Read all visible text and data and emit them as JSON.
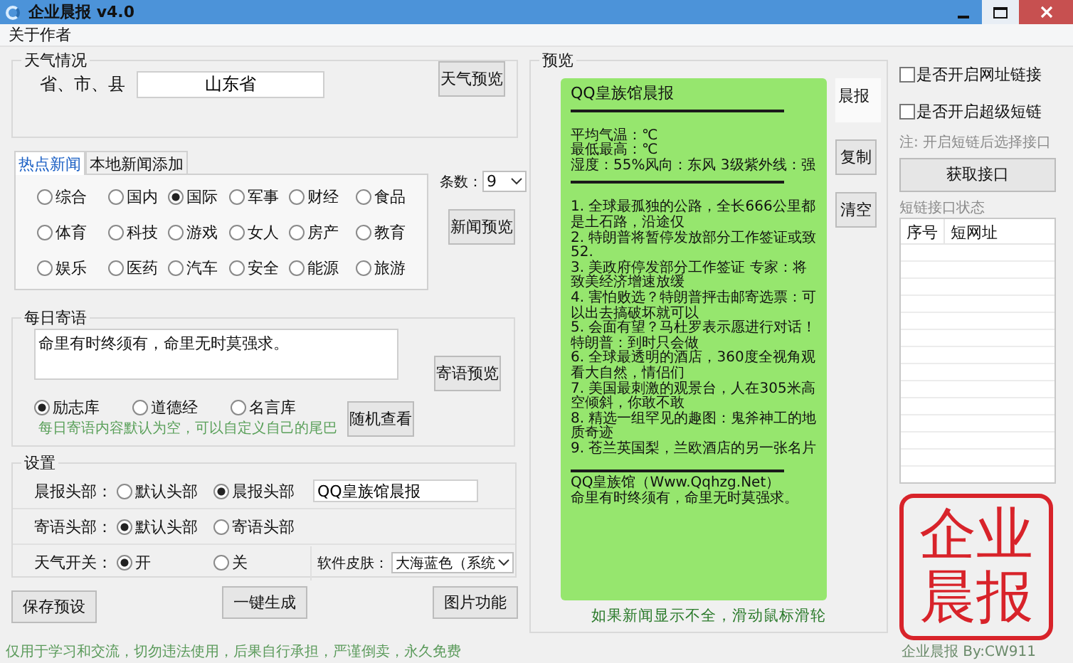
{
  "window": {
    "title": "企业晨报 v4.0"
  },
  "menu": [
    "关于作者"
  ],
  "weather": {
    "title": "天气情况",
    "label": "省、市、县",
    "value": "山东省",
    "button": "天气预览"
  },
  "news": {
    "tabs": [
      {
        "label": "热点新闻",
        "selected": true
      },
      {
        "label": "本地新闻添加",
        "selected": false
      }
    ],
    "categories": [
      {
        "label": "综合",
        "selected": false
      },
      {
        "label": "国内",
        "selected": false
      },
      {
        "label": "国际",
        "selected": true
      },
      {
        "label": "军事",
        "selected": false
      },
      {
        "label": "财经",
        "selected": false
      },
      {
        "label": "食品",
        "selected": false
      },
      {
        "label": "体育",
        "selected": false
      },
      {
        "label": "科技",
        "selected": false
      },
      {
        "label": "游戏",
        "selected": false
      },
      {
        "label": "女人",
        "selected": false
      },
      {
        "label": "房产",
        "selected": false
      },
      {
        "label": "教育",
        "selected": false
      },
      {
        "label": "娱乐",
        "selected": false
      },
      {
        "label": "医药",
        "selected": false
      },
      {
        "label": "汽车",
        "selected": false
      },
      {
        "label": "安全",
        "selected": false
      },
      {
        "label": "能源",
        "selected": false
      },
      {
        "label": "旅游",
        "selected": false
      }
    ],
    "count_label": "条数：",
    "count_value": "9",
    "button": "新闻预览"
  },
  "motto": {
    "title": "每日寄语",
    "text": "命里有时终须有，命里无时莫强求。",
    "preview_button": "寄语预览",
    "sources": [
      {
        "label": "励志库",
        "selected": true
      },
      {
        "label": "道德经",
        "selected": false
      },
      {
        "label": "名言库",
        "selected": false
      }
    ],
    "random_button": "随机查看",
    "hint": "每日寄语内容默认为空，可以自定义自己的尾巴"
  },
  "settings": {
    "title": "设置",
    "rows": [
      {
        "label": "晨报头部：",
        "options": [
          {
            "label": "默认头部",
            "selected": false
          },
          {
            "label": "晨报头部",
            "selected": true
          }
        ],
        "value": "QQ皇族馆晨报"
      },
      {
        "label": "寄语头部：",
        "options": [
          {
            "label": "默认头部",
            "selected": true
          },
          {
            "label": "寄语头部",
            "selected": false
          }
        ]
      },
      {
        "label": "天气开关：",
        "options": [
          {
            "label": "开",
            "selected": true
          },
          {
            "label": "关",
            "selected": false
          }
        ],
        "skin_label": "软件皮肤：",
        "skin_value": "大海蓝色（系统"
      }
    ]
  },
  "buttons": [
    "保存预设",
    "一键生成",
    "图片功能"
  ],
  "preview": {
    "title": "预览",
    "header": "QQ皇族馆晨报",
    "weather_lines": [
      "平均气温：℃",
      "最低最高：℃",
      "湿度：55%风向：东风 3级紫外线：强"
    ],
    "news": [
      "1. 全球最孤独的公路，全长666公里都是土石路，沿途仅",
      "2. 特朗普将暂停发放部分工作签证或致52.",
      "3. 美政府停发部分工作签证 专家：将致美经济增速放缓",
      "4. 害怕败选？特朗普抨击邮寄选票：可以出去搞破坏就可以",
      "5. 会面有望？马杜罗表示愿进行对话！特朗普：到时只会做",
      "6. 全球最透明的酒店，360度全视角观看大自然，情侣们",
      "7. 美国最刺激的观景台，人在305米高空倾斜，你敢不敢",
      "8. 精选一组罕见的趣图：鬼斧神工的地质奇迹",
      "9. 苍兰英国梨，兰欧酒店的另一张名片"
    ],
    "site": "QQ皇族馆（Www.Qqhzg.Net）",
    "motto": "命里有时终须有，命里无时莫强求。",
    "side_tab": "晨报",
    "buttons": [
      "复制",
      "清空"
    ],
    "hint": "如果新闻显示不全，滑动鼠标滑轮"
  },
  "links": {
    "options": [
      {
        "label": "是否开启网址链接",
        "checked": false
      },
      {
        "label": "是否开启超级短链",
        "checked": false
      }
    ],
    "note": "注: 开启短链后选择接口",
    "button": "获取接口",
    "status_title": "短链接口状态",
    "columns": [
      "序号",
      "短网址"
    ]
  },
  "stamp": {
    "text": "企业晨报"
  },
  "status_bar": {
    "left": "仅用于学习和交流，切勿违法使用，后果自行承担，严谨倒卖，永久免费",
    "right": "企业晨报 By:CW911"
  }
}
